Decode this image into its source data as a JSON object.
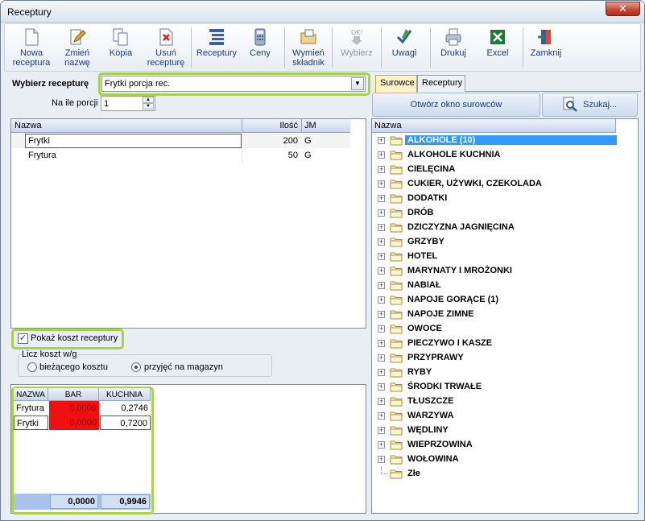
{
  "window": {
    "title": "Receptury",
    "close_glyph": "✕"
  },
  "toolbar": {
    "buttons": [
      {
        "id": "new",
        "label": "Nowa receptura",
        "icon": "new-document-icon",
        "enabled": true
      },
      {
        "id": "rename",
        "label": "Zmień nazwę",
        "icon": "rename-pencil-icon",
        "enabled": true
      },
      {
        "id": "copy",
        "label": "Kopia",
        "icon": "copy-icon",
        "enabled": true
      },
      {
        "id": "delete",
        "label": "Usuń recepturę",
        "icon": "delete-document-icon",
        "enabled": true
      },
      {
        "id": "recipes",
        "label": "Receptury",
        "icon": "list-tree-icon",
        "enabled": true
      },
      {
        "id": "prices",
        "label": "Ceny",
        "icon": "calculator-icon",
        "enabled": true
      },
      {
        "id": "replace",
        "label": "Wymień składnik",
        "icon": "replace-folder-icon",
        "enabled": true
      },
      {
        "id": "choose",
        "label": "Wybierz",
        "icon": "ok-arrow-icon",
        "enabled": false
      },
      {
        "id": "notes",
        "label": "Uwagi",
        "icon": "notes-pen-icon",
        "enabled": true
      },
      {
        "id": "print",
        "label": "Drukuj",
        "icon": "printer-icon",
        "enabled": true
      },
      {
        "id": "excel",
        "label": "Excel",
        "icon": "excel-icon",
        "enabled": true
      },
      {
        "id": "close",
        "label": "Zamknij",
        "icon": "exit-door-icon",
        "enabled": true
      }
    ]
  },
  "recipe": {
    "select_label": "Wybierz recepturę",
    "selected": "Frytki porcja rec.",
    "portions_label": "Na ile porcji",
    "portions": "1"
  },
  "ingredients": {
    "columns": [
      "Nazwa",
      "Ilość",
      "JM"
    ],
    "rows": [
      {
        "name": "Frytki",
        "qty": "200",
        "unit": "G"
      },
      {
        "name": "Frytura",
        "qty": "50",
        "unit": "G"
      }
    ]
  },
  "cost": {
    "show_cost_label": "Pokaż koszt receptury",
    "show_cost_checked": true,
    "calc_label": "Licz koszt w/g",
    "option_current": "bieżącego kosztu",
    "option_receipts": "przyjęć na magazyn",
    "selected_option": "receipts",
    "columns": [
      "NAZWA",
      "BAR",
      "KUCHNIA"
    ],
    "rows": [
      {
        "name": "Frytura",
        "bar": "0,0000",
        "kuchnia": "0,2746"
      },
      {
        "name": "Frytki",
        "bar": "0,0000",
        "kuchnia": "0,7200"
      }
    ],
    "totals": {
      "bar": "0,0000",
      "kuchnia": "0,9946"
    }
  },
  "right": {
    "tabs": [
      "Surowce",
      "Receptury"
    ],
    "active_tab": "Surowce",
    "open_button": "Otwórz okno surowców",
    "search_button": "Szukaj...",
    "tree_header": "Nazwa",
    "tree": [
      "ALKOHOLE (10)",
      "ALKOHOLE KUCHNIA",
      "CIELĘCINA",
      "CUKIER, UŻYWKI, CZEKOLADA",
      "DODATKI",
      "DRÓB",
      "DZICZYZNA JAGNIĘCINA",
      "GRZYBY",
      "HOTEL",
      "MARYNATY I MROŻONKI",
      "NABIAŁ",
      "NAPOJE GORĄCE (1)",
      "NAPOJE ZIMNE",
      "OWOCE",
      "PIECZYWO I KASZE",
      "PRZYPRAWY",
      "RYBY",
      "ŚRODKI TRWAŁE",
      "TŁUSZCZE",
      "WARZYWA",
      "WĘDLINY",
      "WIEPRZOWINA",
      "WOŁOWINA",
      "Złe"
    ],
    "selected_index": 0
  },
  "colors": {
    "highlight": "#a7d24a",
    "selection": "#3399ff",
    "negative_cell": "#f01010"
  }
}
